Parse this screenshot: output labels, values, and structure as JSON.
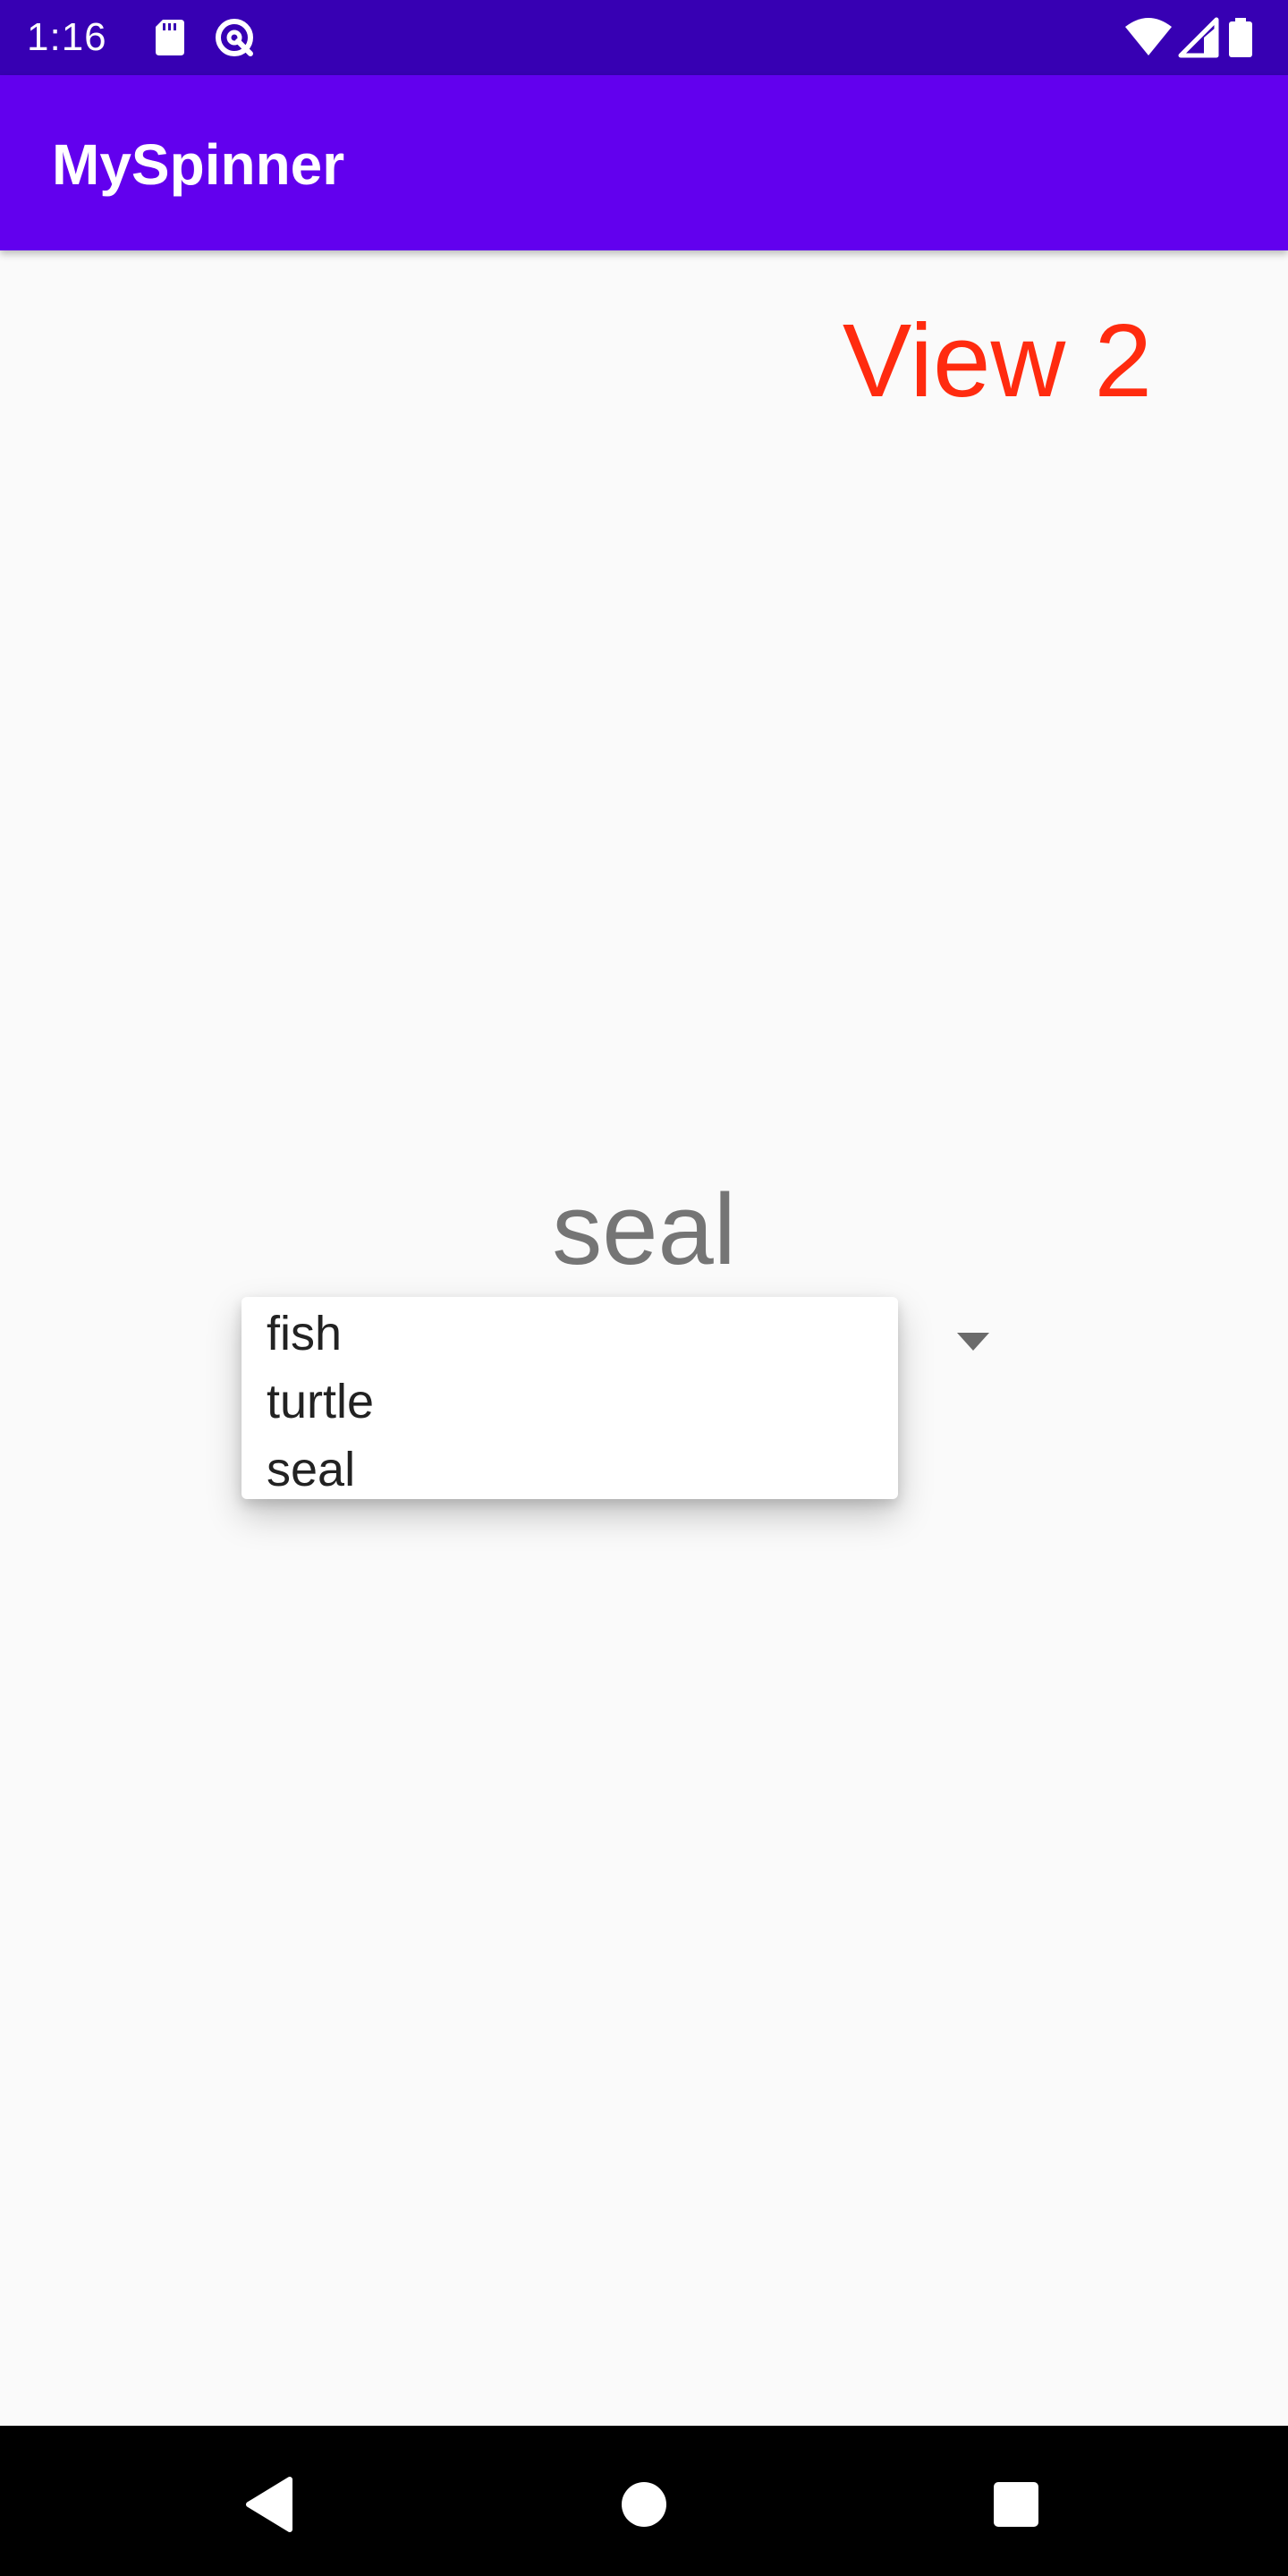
{
  "status_bar": {
    "time": "1:16",
    "icons": [
      "sd-card-icon",
      "data-saver-icon",
      "wifi-icon",
      "signal-icon",
      "battery-icon"
    ]
  },
  "app_bar": {
    "title": "MySpinner"
  },
  "main": {
    "view_label": "View 2",
    "spinner": {
      "selected_value": "seal",
      "options": [
        "fish",
        "turtle",
        "seal"
      ]
    }
  },
  "nav_bar": {
    "buttons": [
      "back-icon",
      "home-icon",
      "recents-icon"
    ]
  },
  "colors": {
    "status_bar": "#3700b3",
    "app_bar": "#6200ee",
    "view_label": "#ff2b0f",
    "background": "#fafafa"
  }
}
